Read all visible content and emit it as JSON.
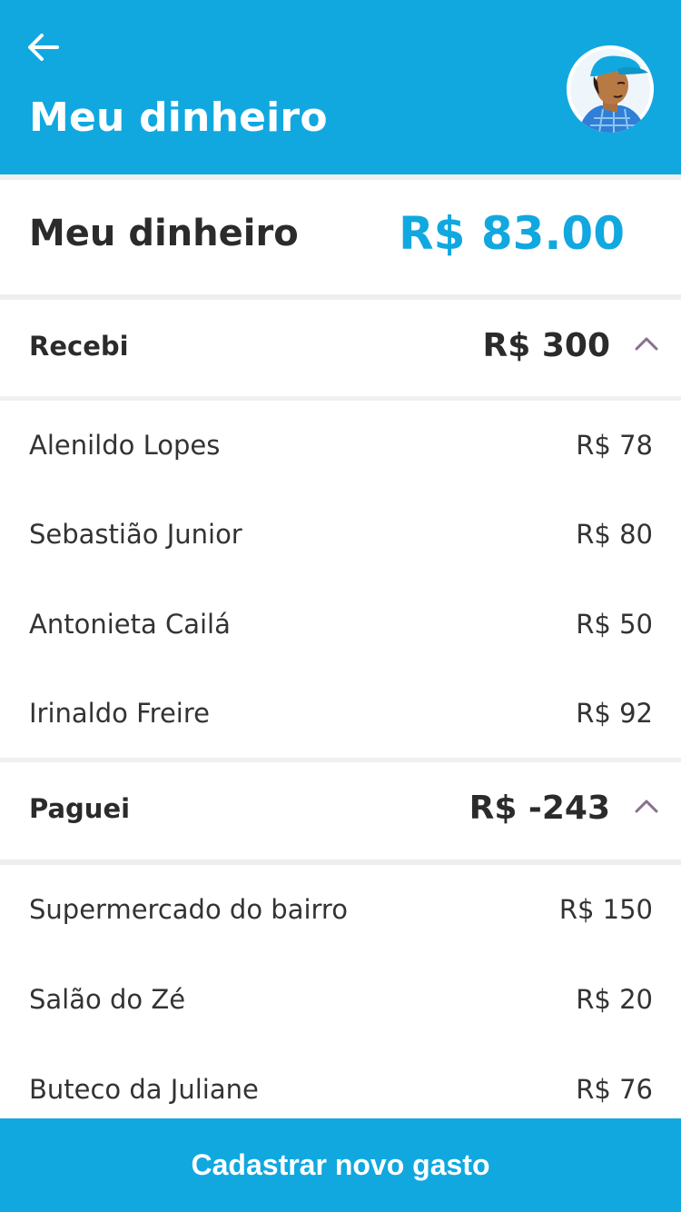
{
  "colors": {
    "accent": "#11a8df",
    "text": "#2b2b2b",
    "chevron": "#8a6f8e",
    "divider": "#eeeeee"
  },
  "header": {
    "title": "Meu dinheiro",
    "back_icon": "arrow-left-icon",
    "avatar_icon": "user-avatar-illustration"
  },
  "summary": {
    "label": "Meu dinheiro",
    "value": "R$ 83.00"
  },
  "received": {
    "label": "Recebi",
    "total": "R$ 300",
    "expanded": true,
    "items": [
      {
        "name": "Alenildo Lopes",
        "value": "R$ 78"
      },
      {
        "name": "Sebastião Junior",
        "value": "R$ 80"
      },
      {
        "name": "Antonieta Cailá",
        "value": "R$ 50"
      },
      {
        "name": "Irinaldo Freire",
        "value": "R$ 92"
      }
    ]
  },
  "paid": {
    "label": "Paguei",
    "total": "R$ -243",
    "expanded": true,
    "items": [
      {
        "name": "Supermercado do bairro",
        "value": "R$ 150"
      },
      {
        "name": "Salão do Zé",
        "value": "R$ 20"
      },
      {
        "name": "Buteco da Juliane",
        "value": "R$ 76"
      }
    ]
  },
  "cta": {
    "label": "Cadastrar novo gasto"
  }
}
